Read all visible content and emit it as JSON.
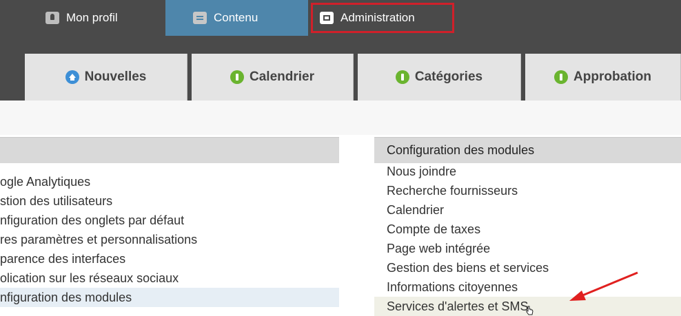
{
  "top_nav": {
    "tabs": [
      {
        "label": "Mon profil",
        "icon": "person-icon"
      },
      {
        "label": "Contenu",
        "icon": "document-icon"
      },
      {
        "label": "Administration",
        "icon": "admin-icon"
      }
    ],
    "active_color": "#4e86ab",
    "highlight_color": "#d0202a"
  },
  "sub_tabs": [
    {
      "label": "Nouvelles",
      "icon": "home-icon"
    },
    {
      "label": "Calendrier",
      "icon": "green-circle-icon"
    },
    {
      "label": "Catégories",
      "icon": "green-circle-icon"
    },
    {
      "label": "Approbation",
      "icon": "green-circle-icon"
    }
  ],
  "left_panel": {
    "items": [
      "ogle Analytiques",
      "stion des utilisateurs",
      "nfiguration des onglets par défaut",
      "res paramètres et personnalisations",
      "parence des interfaces",
      "olication sur les réseaux sociaux",
      "nfiguration des modules"
    ]
  },
  "right_panel": {
    "header": "Configuration des modules",
    "items": [
      "Nous joindre",
      "Recherche fournisseurs",
      "Calendrier",
      "Compte de taxes",
      "Page web intégrée",
      "Gestion des biens et services",
      "Informations citoyennes",
      "Services d'alertes et SMS"
    ]
  }
}
